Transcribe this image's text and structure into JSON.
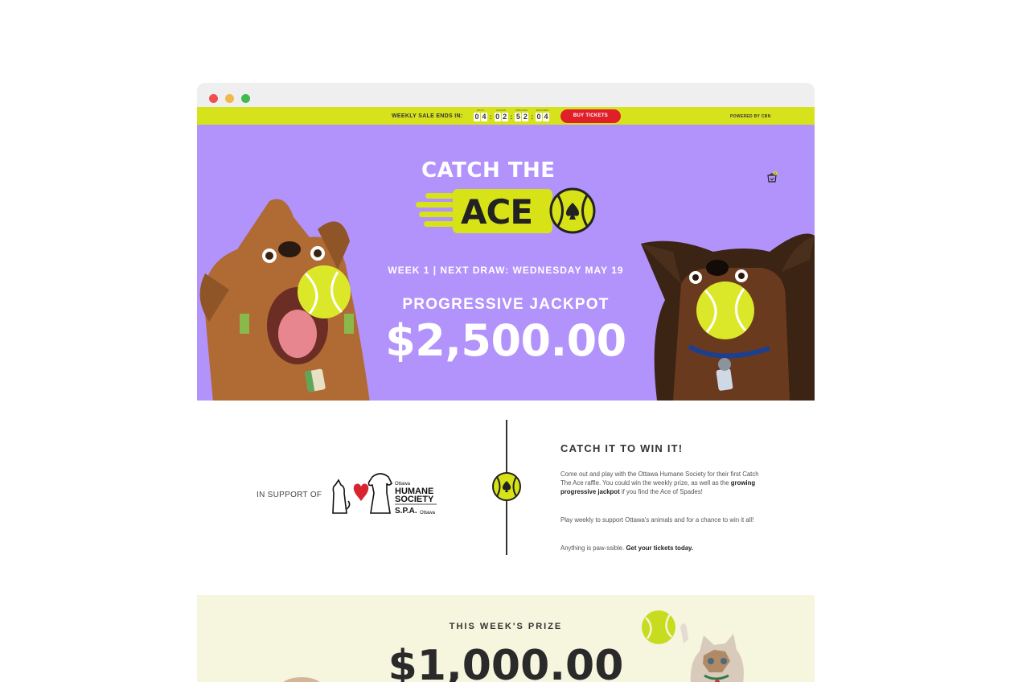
{
  "topbar": {
    "sale_label": "WEEKLY SALE ENDS IN:",
    "countdown": [
      {
        "label": "DAYS",
        "digits": [
          "0",
          "4"
        ]
      },
      {
        "label": "HOURS",
        "digits": [
          "0",
          "2"
        ]
      },
      {
        "label": "MINUTES",
        "digits": [
          "5",
          "2"
        ]
      },
      {
        "label": "SECONDS",
        "digits": [
          "0",
          "4"
        ]
      }
    ],
    "buy_button": "BUY TICKETS",
    "powered_by": "POWERED BY CBN"
  },
  "hero": {
    "logo_top": "CATCH THE",
    "logo_bottom": "ACE",
    "week_line": "WEEK 1  |  NEXT DRAW: WEDNESDAY MAY 19",
    "jackpot_label": "PROGRESSIVE JACKPOT",
    "jackpot_amount": "$2,500.00",
    "cart_count": "2"
  },
  "support": {
    "in_support_of": "IN SUPPORT OF",
    "hs_logo": {
      "ottawa": "Ottawa",
      "humane": "HUMANE",
      "society": "SOCIETY",
      "spa": "S.P.A.",
      "ottawa2": "Ottawa"
    },
    "title": "CATCH IT TO WIN IT!",
    "p1_a": "Come out and play with the Ottawa Humane Society for their first Catch The Ace raffle. You could win the weekly prize, as well as the ",
    "p1_bold": "growing progressive jackpot",
    "p1_b": " if you find the Ace of Spades!",
    "p2": "Play weekly to support Ottawa's animals and for a chance to win it all!",
    "p3_a": "Anything is paw-ssible. ",
    "p3_bold": "Get your tickets today."
  },
  "prize": {
    "label": "THIS WEEK'S PRIZE",
    "amount": "$1,000.00"
  },
  "colors": {
    "purple": "#b293fc",
    "lime": "#d6e21c",
    "red": "#e01f2a",
    "cream": "#f6f5de"
  }
}
